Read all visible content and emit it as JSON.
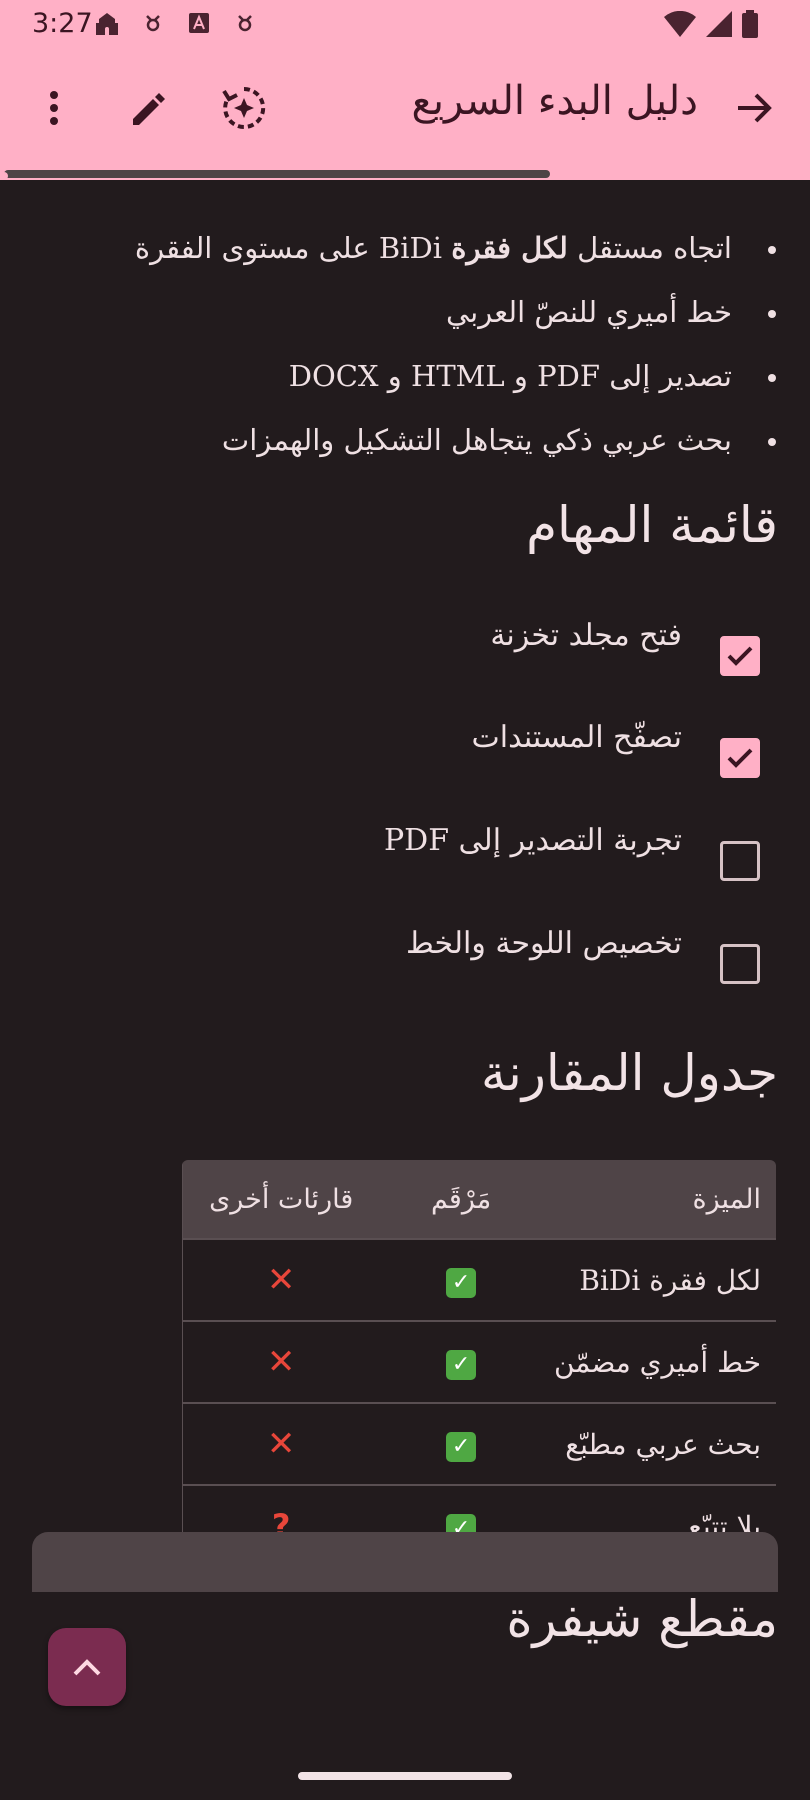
{
  "status_bar": {
    "time": "3:27",
    "icons": [
      "mosque-icon",
      "notification-icon",
      "font-icon",
      "notification-icon"
    ],
    "right_icons": [
      "wifi-icon",
      "signal-icon",
      "battery-icon"
    ]
  },
  "app_bar": {
    "title": "دليل البدء السريع",
    "back_icon": "arrow-right-icon",
    "actions": [
      "sparkle-rotate-icon",
      "edit-icon",
      "more-vertical-icon"
    ]
  },
  "features": [
    {
      "text_before": "اتجاه مستقل ",
      "bold": "لكل فقرة",
      "text_after": " BiDi على مستوى الفقرة"
    },
    {
      "text": "خط أميري للنصّ العربي"
    },
    {
      "text": "تصدير إلى PDF و HTML و DOCX"
    },
    {
      "text": "بحث عربي ذكي يتجاهل التشكيل والهمزات"
    }
  ],
  "tasks_heading": "قائمة المهام",
  "tasks": [
    {
      "label": "فتح مجلد تخزنة",
      "checked": true
    },
    {
      "label": "تصفّح المستندات",
      "checked": true
    },
    {
      "label": "تجربة التصدير إلى PDF",
      "checked": false
    },
    {
      "label": "تخصيص اللوحة والخط",
      "checked": false
    }
  ],
  "table_heading": "جدول المقارنة",
  "table": {
    "headers": [
      "الميزة",
      "مَرْقَم",
      "قارئات أخرى"
    ],
    "rows": [
      {
        "feature": "لكل فقرة BiDi",
        "ours": "✓",
        "others": "✕"
      },
      {
        "feature": "خط أميري مضمّن",
        "ours": "✓",
        "others": "✕"
      },
      {
        "feature": "بحث عربي مطبّع",
        "ours": "✓",
        "others": "✕"
      },
      {
        "feature": "بلا تتبّع",
        "ours": "✓",
        "others": "?"
      }
    ]
  },
  "code_heading": "مقطع شيفرة",
  "fab_icon": "chevron-up-icon",
  "colors": {
    "app_bar": "#ffb0c6",
    "background": "#221b1d",
    "check_green": "#4fa843",
    "cross_red": "#e8463a",
    "fab": "#7b2c50"
  }
}
